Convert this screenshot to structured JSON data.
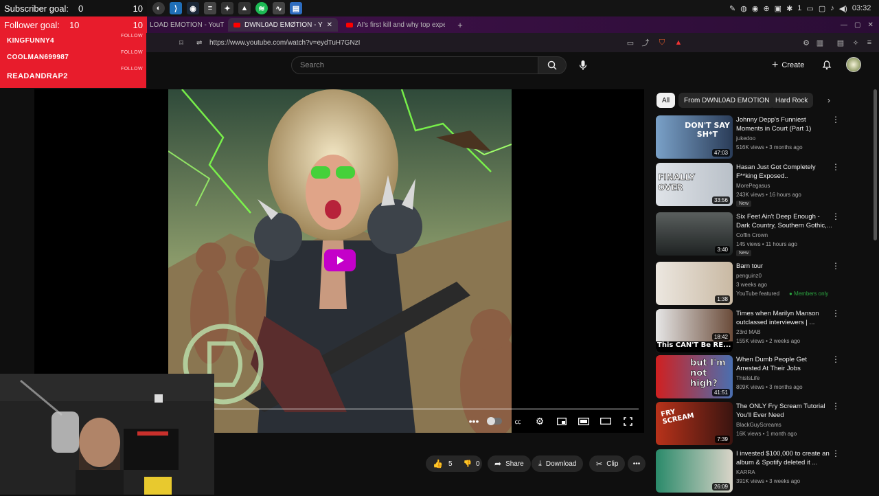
{
  "os": {
    "clock": "03:32",
    "battery_count": "1"
  },
  "overlay": {
    "subscriber_label": "Subscriber goal:",
    "subscriber_current": "0",
    "subscriber_target": "10",
    "follower_label": "Follower goal:",
    "follower_target": "10",
    "alerts": [
      {
        "name": "KINGFUNNY4",
        "tag": "FOLLOW"
      },
      {
        "name": "COOLMAN699987",
        "tag": "FOLLOW"
      },
      {
        "name": "READANDRAP2",
        "tag": "FOLLOW"
      }
    ]
  },
  "browser": {
    "tabs": [
      {
        "title": "LOAD EMOTION - YouT"
      },
      {
        "title": "DWNL0AD EMØTION - Y"
      },
      {
        "title": "AI's first kill and why top expe"
      }
    ],
    "url": "https://www.youtube.com/watch?v=eydTuH7GNzI"
  },
  "masthead": {
    "search_placeholder": "Search",
    "create_label": "Create"
  },
  "actions": {
    "likes": "5",
    "dislikes": "0",
    "share": "Share",
    "download": "Download",
    "clip": "Clip"
  },
  "chips": [
    "All",
    "From DWNL0AD EMOTION",
    "Hard Rock"
  ],
  "recommendations": [
    {
      "title": "Johnny Depp's Funniest Moments in Court (Part 1)",
      "channel": "jukedoo",
      "meta": "516K views • 3 months ago",
      "duration": "47:03",
      "badge": "",
      "thumb_text": "DON'T SAY SH*T"
    },
    {
      "title": "Hasan Just Got Completely F**king Exposed..",
      "channel": "MorePegasus",
      "meta": "243K views • 16 hours ago",
      "duration": "33:56",
      "badge": "New",
      "thumb_text": "FINALLY OVER"
    },
    {
      "title": "Six Feet Ain't Deep Enough - Dark Country, Southern Gothic,...",
      "channel": "Coffin Crown",
      "meta": "145 views • 11 hours ago",
      "duration": "3:40",
      "badge": "New",
      "thumb_text": ""
    },
    {
      "title": "Barn tour",
      "channel": "penguinz0",
      "meta": "3 weeks ago",
      "duration": "1:38",
      "badge": "YouTube featured",
      "members": "Members only",
      "thumb_text": ""
    },
    {
      "title": "Times when Marilyn Manson outclassed interviewers | ...",
      "channel": "23rd MAB",
      "meta": "155K views • 2 weeks ago",
      "duration": "18:42",
      "badge": "",
      "thumb_text": "This CAN'T Be RE..."
    },
    {
      "title": "When Dumb People Get Arrested At Their Jobs",
      "channel": "ThisIsLife",
      "meta": "809K views • 3 months ago",
      "duration": "41:51",
      "badge": "",
      "thumb_text": "but I'm not high?"
    },
    {
      "title": "The ONLY Fry Scream Tutorial You'll Ever Need",
      "channel": "BlackGuyScreams",
      "meta": "16K views • 1 month ago",
      "duration": "7:39",
      "badge": "",
      "thumb_text": "FRY SCREAM"
    },
    {
      "title": "I invested $100,000 to create an album & Spotify deleted it ...",
      "channel": "KARRA",
      "meta": "391K views • 3 weeks ago",
      "duration": "26:09",
      "badge": "",
      "thumb_text": ""
    }
  ]
}
